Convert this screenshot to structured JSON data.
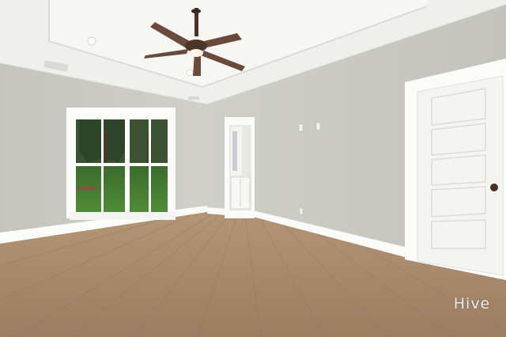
{
  "watermark": {
    "text": "Hive"
  },
  "colors": {
    "ceiling": "#f3f3f1",
    "ceiling_recess": "#f7f7f5",
    "wall_left": "#cbcbc3",
    "wall_right": "#c9c9c2",
    "trim": "#fbfbfa",
    "floor": "#a98a6e",
    "fan_blade": "#6a4a3a",
    "lawn": "#3f7d2e",
    "trees": "#2f4a2a"
  },
  "icons": {
    "ceiling_fan": "ceiling-fan-icon",
    "door_knob": "door-knob-icon"
  }
}
